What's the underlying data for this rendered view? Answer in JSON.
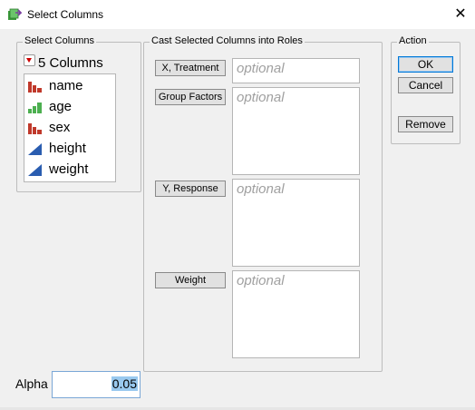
{
  "window": {
    "title": "Select Columns",
    "close_icon": "close-icon"
  },
  "select_columns": {
    "group_label": "Select Columns",
    "toggle_label": "5 Columns",
    "columns": [
      {
        "label": "name",
        "icon": "nominal-bar-icon",
        "color": "#c0392b"
      },
      {
        "label": "age",
        "icon": "ordinal-bar-icon",
        "color": "#4caf50"
      },
      {
        "label": "sex",
        "icon": "nominal-bar-icon",
        "color": "#c0392b"
      },
      {
        "label": "height",
        "icon": "continuous-triangle-icon",
        "color": "#2a5db0"
      },
      {
        "label": "weight",
        "icon": "continuous-triangle-icon",
        "color": "#2a5db0"
      }
    ]
  },
  "roles": {
    "group_label": "Cast Selected Columns into Roles",
    "items": [
      {
        "button": "X, Treatment",
        "placeholder": "optional"
      },
      {
        "button": "Group Factors",
        "placeholder": "optional"
      },
      {
        "button": "Y, Response",
        "placeholder": "optional"
      },
      {
        "button": "Weight",
        "placeholder": "optional"
      }
    ]
  },
  "action": {
    "group_label": "Action",
    "ok": "OK",
    "cancel": "Cancel",
    "remove": "Remove"
  },
  "alpha": {
    "label": "Alpha",
    "value": "0.05"
  }
}
